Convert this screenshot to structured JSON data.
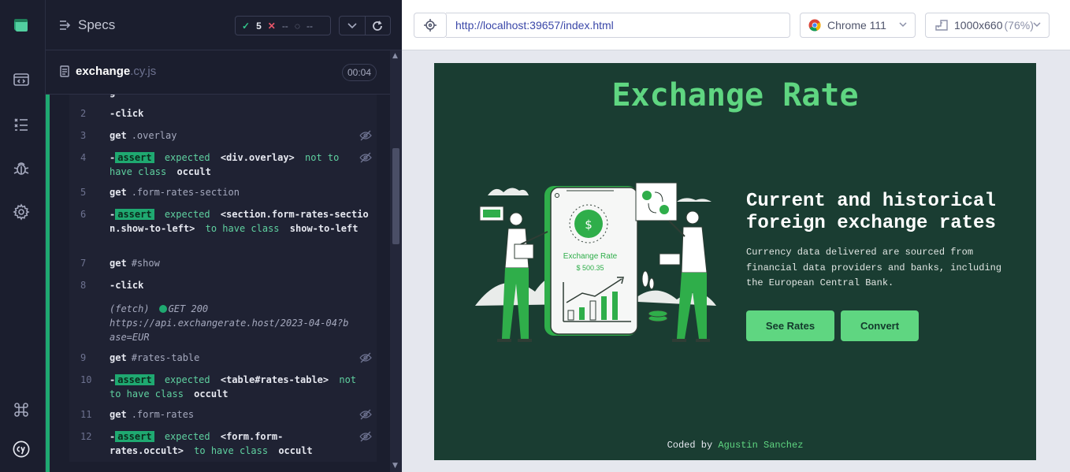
{
  "specs": {
    "title": "Specs",
    "passed": "5",
    "failed": "--",
    "pending": "--",
    "file_name": "exchange",
    "file_ext": ".cy.js",
    "duration": "00:04"
  },
  "commands": [
    {
      "num": "2",
      "type": "simple",
      "kw": "-click",
      "sel": ""
    },
    {
      "num": "3",
      "type": "simple",
      "kw": "get",
      "sel": ".overlay",
      "eye": true
    },
    {
      "num": "4",
      "type": "assert",
      "tag": "assert",
      "lines": [
        "expected",
        "<div.overlay>",
        "not to have class",
        "occult"
      ],
      "eye": true
    },
    {
      "num": "5",
      "type": "simple",
      "kw": "get",
      "sel": ".form-rates-section"
    },
    {
      "num": "6",
      "type": "assert",
      "tag": "assert",
      "lines": [
        "expected",
        "<section.form-rates-section.show-to-left>",
        "to have class",
        "show-to-left"
      ]
    },
    {
      "num": "7",
      "type": "simple",
      "kw": "get",
      "sel": "#show"
    },
    {
      "num": "8",
      "type": "simple",
      "kw": "-click",
      "sel": ""
    },
    {
      "num": "",
      "type": "fetch",
      "label": "(fetch)",
      "status": "GET 200",
      "url": "https://api.exchangerate.host/2023-04-04?base=EUR"
    },
    {
      "num": "9",
      "type": "simple",
      "kw": "get",
      "sel": "#rates-table",
      "eye": true
    },
    {
      "num": "10",
      "type": "assert",
      "tag": "assert",
      "lines": [
        "expected",
        "<table#rates-table>",
        "not to have class",
        "occult"
      ]
    },
    {
      "num": "11",
      "type": "simple",
      "kw": "get",
      "sel": ".form-rates",
      "eye": true
    },
    {
      "num": "12",
      "type": "assert",
      "tag": "assert",
      "lines": [
        "expected",
        "<form.form-rates.occult>",
        "to have class",
        "occult"
      ],
      "eye": true
    }
  ],
  "browser": {
    "url": "http://localhost:39657/index.html",
    "browser_name": "Chrome 111",
    "viewport": "1000x660",
    "scale": "(76%)"
  },
  "app": {
    "title": "Exchange Rate",
    "heading": "Current and historical foreign exchange rates",
    "description": "Currency data delivered are sourced from financial data providers and banks, including the European Central Bank.",
    "btn_rates": "See Rates",
    "btn_convert": "Convert",
    "illus_label": "Exchange Rate",
    "illus_amount": "$ 500.35",
    "footer_prefix": "Coded by",
    "footer_author": "Agustin Sanchez"
  },
  "colors": {
    "accent": "#1fa971",
    "app_bg": "#1a3d32",
    "app_green": "#5fd681"
  }
}
